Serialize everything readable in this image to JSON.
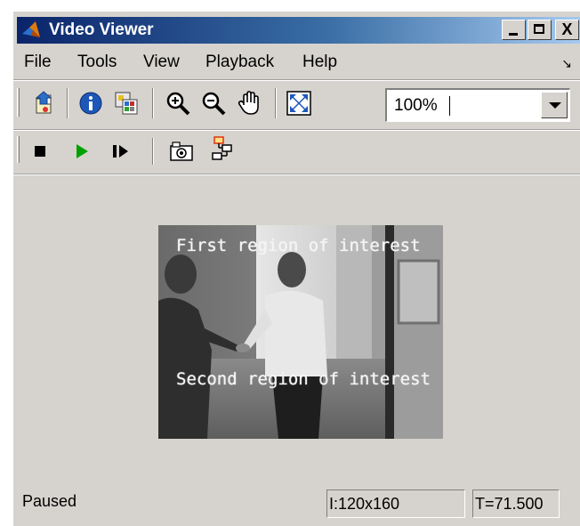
{
  "window": {
    "title": "Video Viewer",
    "controls": {
      "minimize": "_",
      "maximize": "□",
      "close": "X"
    }
  },
  "menu": {
    "items": [
      "File",
      "Tools",
      "View",
      "Playback",
      "Help"
    ],
    "overflow_icon": "dock-arrow-icon"
  },
  "toolbar": {
    "top_icons": [
      "import-icon",
      "info-icon",
      "pixel-region-icon",
      "zoom-in-icon",
      "zoom-out-icon",
      "pan-hand-icon",
      "fit-to-window-icon"
    ],
    "zoom": {
      "value": "100%"
    }
  },
  "playback_toolbar": {
    "icons": [
      "stop-icon",
      "play-icon",
      "step-forward-icon",
      "snapshot-icon",
      "highlight-simulink-icon"
    ]
  },
  "video": {
    "labels": [
      "First region of interest",
      "Second region of interest"
    ]
  },
  "status": {
    "state": "Paused",
    "image_size": "I:120x160",
    "time": "T=71.500"
  },
  "colors": {
    "chrome": "#d6d3ce",
    "titlebar_start": "#0a246a",
    "titlebar_end": "#a6caf0",
    "play_green": "#00a000"
  }
}
